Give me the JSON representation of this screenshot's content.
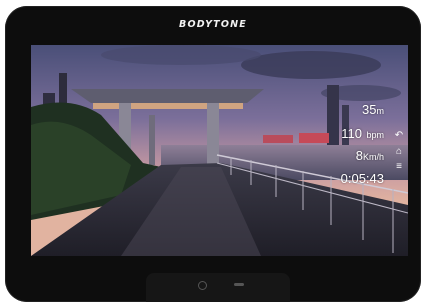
{
  "brand": "BODYTONE",
  "hud": {
    "distance_value": "35",
    "distance_unit": "m",
    "heart_rate_value": "110",
    "heart_rate_unit": "bpm",
    "speed_value": "8",
    "speed_unit": "Km/h",
    "elapsed_time": "0:05:43"
  },
  "side_icons": [
    "return-arrow-icon",
    "home-icon",
    "menu-icon"
  ]
}
